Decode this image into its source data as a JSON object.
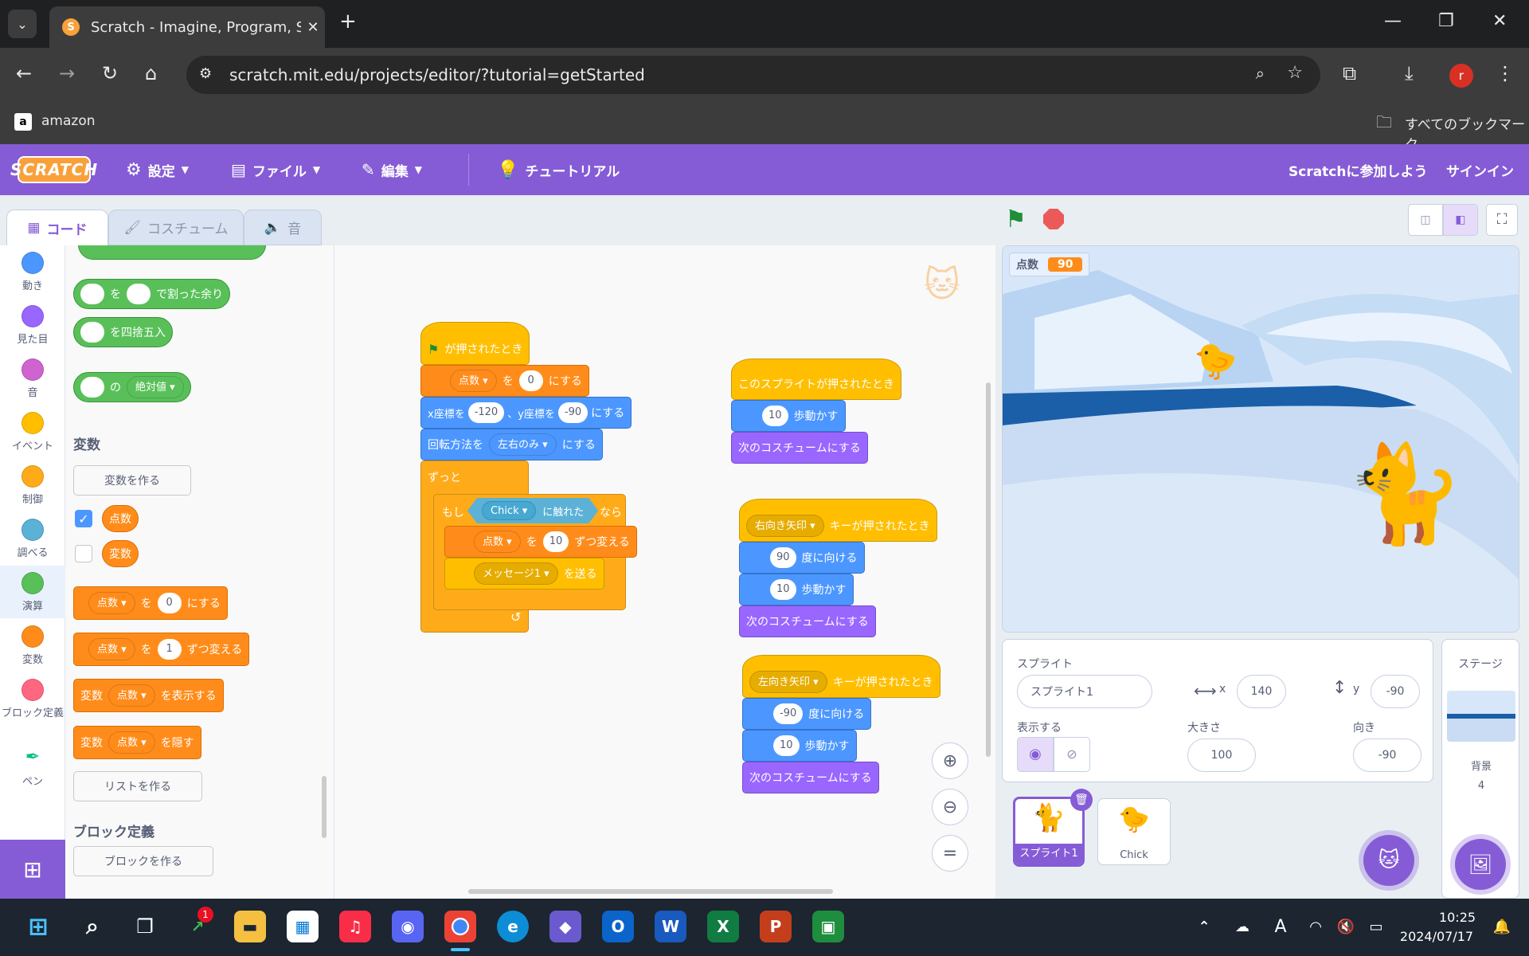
{
  "browser": {
    "tab_title": "Scratch - Imagine, Program, Sha",
    "url": "scratch.mit.edu/projects/editor/?tutorial=getStarted",
    "bookmark": "amazon",
    "bookmarks_folder": "すべてのブックマーク",
    "profile_initial": "r"
  },
  "menu": {
    "logo": "SCRATCH",
    "settings": "設定",
    "file": "ファイル",
    "edit": "編集",
    "tutorial": "チュートリアル",
    "join": "Scratchに参加しよう",
    "signin": "サインイン"
  },
  "editor_tabs": {
    "code": "コード",
    "costume": "コスチューム",
    "sound": "音"
  },
  "categories": [
    {
      "label": "動き",
      "color": "#4c97ff"
    },
    {
      "label": "見た目",
      "color": "#9966ff"
    },
    {
      "label": "音",
      "color": "#cf63cf"
    },
    {
      "label": "イベント",
      "color": "#ffbf00"
    },
    {
      "label": "制御",
      "color": "#ffab19"
    },
    {
      "label": "調べる",
      "color": "#5cb1d6"
    },
    {
      "label": "演算",
      "color": "#59c059"
    },
    {
      "label": "変数",
      "color": "#ff8c1a"
    },
    {
      "label": "ブロック定義",
      "color": "#ff6680"
    },
    {
      "label": "ペン",
      "color": "#0fbd8c"
    }
  ],
  "palette": {
    "mod_text": "を",
    "mod_tail": "で割った余り",
    "round_text": "を四捨五入",
    "abs_of": "の",
    "abs_fn": "絶対値",
    "variables_header": "変数",
    "make_variable": "変数を作る",
    "var1": "点数",
    "var2": "変数",
    "set_var": "点数",
    "set_to": "を",
    "set_val": "0",
    "set_tail": "にする",
    "change_var": "点数",
    "change_by": "を",
    "change_val": "1",
    "change_tail": "ずつ変える",
    "show_prefix": "変数",
    "show_var": "点数",
    "show_tail": "を表示する",
    "hide_prefix": "変数",
    "hide_var": "点数",
    "hide_tail": "を隠す",
    "make_list": "リストを作る",
    "myblocks_header": "ブロック定義",
    "make_block": "ブロックを作る"
  },
  "script1": {
    "hat": "が押されたとき",
    "set_var": "点数",
    "set_to": "を",
    "set_val": "0",
    "set_tail": "にする",
    "goto_x": "x座標を",
    "x_val": "-120",
    "goto_y": "、y座標を",
    "y_val": "-90",
    "goto_tail": "にする",
    "rot": "回転方法を",
    "rot_val": "左右のみ",
    "rot_tail": "にする",
    "forever": "ずっと",
    "if": "もし",
    "touch_obj": "Chick",
    "touch_tail": "に触れた",
    "then": "なら",
    "change_var": "点数",
    "change_by": "を",
    "change_val": "10",
    "change_tail": "ずつ変える",
    "broadcast": "メッセージ1",
    "broadcast_tail": "を送る"
  },
  "script2": {
    "hat": "このスプライトが押されたとき",
    "move_val": "10",
    "move": "歩動かす",
    "next": "次のコスチュームにする"
  },
  "script3": {
    "key": "右向き矢印",
    "hat_tail": "キーが押されたとき",
    "dir_val": "90",
    "dir": "度に向ける",
    "move_val": "10",
    "move": "歩動かす",
    "next": "次のコスチュームにする"
  },
  "script4": {
    "key": "左向き矢印",
    "hat_tail": "キーが押されたとき",
    "dir_val": "-90",
    "dir": "度に向ける",
    "move_val": "10",
    "move": "歩動かす",
    "next": "次のコスチュームにする"
  },
  "stage": {
    "monitor_label": "点数",
    "monitor_value": "90"
  },
  "sprite_info": {
    "sprite_label": "スプライト",
    "sprite_name": "スプライト1",
    "x_label": "x",
    "x": "140",
    "y_label": "y",
    "y": "-90",
    "show_label": "表示する",
    "size_label": "大きさ",
    "size": "100",
    "dir_label": "向き",
    "direction": "-90"
  },
  "sprites": [
    {
      "name": "スプライト1",
      "selected": true
    },
    {
      "name": "Chick",
      "selected": false
    }
  ],
  "stage_panel": {
    "title": "ステージ",
    "backdrops_label": "背景",
    "backdrops_count": "4"
  },
  "taskbar": {
    "time": "10:25",
    "date": "2024/07/17",
    "badge": "1",
    "ime": "A"
  }
}
